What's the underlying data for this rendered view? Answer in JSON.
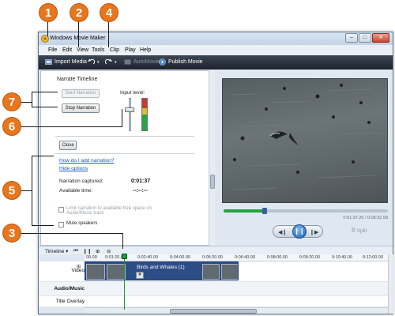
{
  "callouts": {
    "c1": "1",
    "c2": "2",
    "c3": "3",
    "c4": "4",
    "c5": "5",
    "c6": "6",
    "c7": "7"
  },
  "window": {
    "title": "Windows Movie Maker",
    "controls": [
      "–",
      "□",
      "✕"
    ]
  },
  "menu": [
    "File",
    "Edit",
    "View",
    "Tools",
    "Clip",
    "Play",
    "Help"
  ],
  "toolbar": {
    "import": "Import Media",
    "automovie": "AutoMovie",
    "publish": "Publish Movie"
  },
  "narrate": {
    "title": "Narrate Timeline",
    "start_button": "Start Narration",
    "stop_button": "Stop Narration",
    "input_level_label": "Input level:",
    "input_level": 0.7,
    "close_button": "Close",
    "help_link": "How do I add narration?",
    "hide_link": "Hide options",
    "captured_label": "Narration captured:",
    "captured_value": "0:01:37",
    "available_label": "Available time:",
    "available_value": "--:--:--",
    "limit_option": "Limit narration to available free space on Audio/Music track",
    "mute_option": "Mute speakers"
  },
  "preview": {
    "time": "0:01:37.20 / 0:06:32.58",
    "seek_progress": 0.25,
    "split_label": "Split"
  },
  "timeline": {
    "label": "Timeline",
    "ticks": [
      "00.00",
      "0:01:20.00",
      "0:02:40.00",
      "0:04:00.00",
      "0:05:20.00",
      "0:06:40.00",
      "0:08:00.00",
      "0:09:20.00",
      "0:10:40.00",
      "0:12:00.00"
    ],
    "tracks": [
      "Video",
      "Audio/Music",
      "Title Overlay"
    ],
    "clip_title": "Birds and Whales (1)"
  },
  "colors": {
    "accent_orange": "#e8761c",
    "playhead_green": "#1c9b3a",
    "clip_blue": "#2c4d86"
  }
}
